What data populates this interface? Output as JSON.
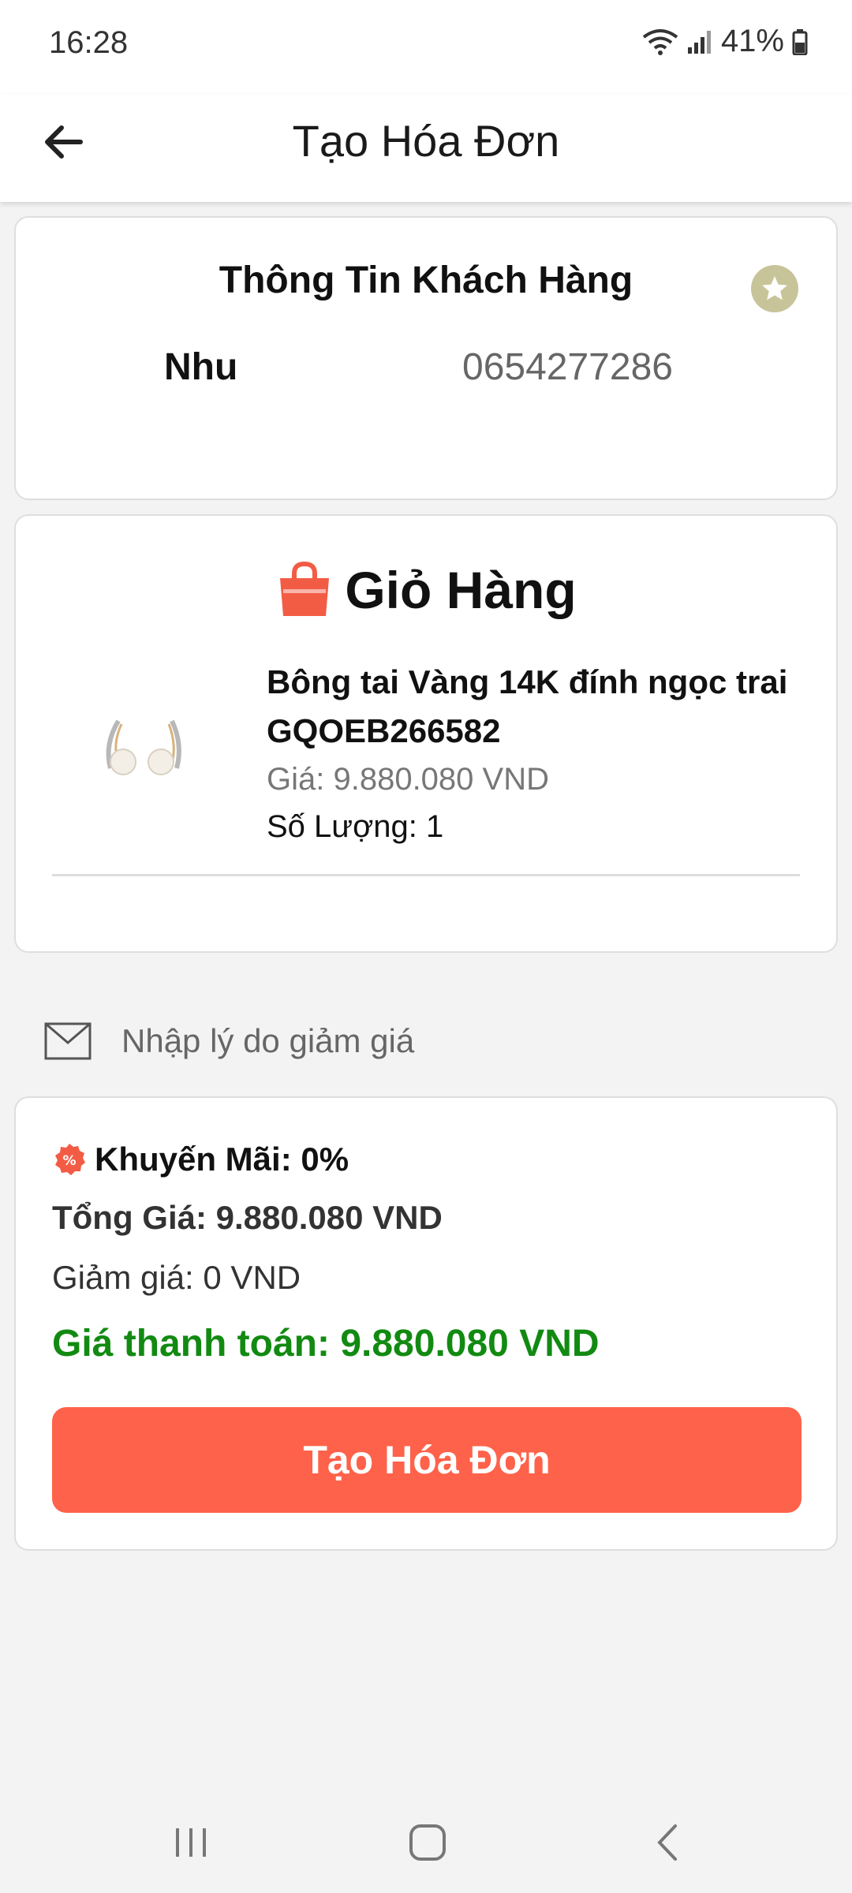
{
  "status_bar": {
    "time": "16:28",
    "battery": "41%"
  },
  "app_bar": {
    "title": "Tạo Hóa Đơn",
    "back_icon": "arrow-left-icon"
  },
  "customer": {
    "title": "Thông Tin Khách Hàng",
    "name": "Nhu",
    "phone": "0654277286",
    "favorite_icon": "star-icon"
  },
  "cart": {
    "title": "Giỏ Hàng",
    "icon": "shopping-bag-icon",
    "items": [
      {
        "name": "Bông tai Vàng 14K đính ngọc trai GQOEB266582",
        "price": "Giá: 9.880.080 VND",
        "quantity": "Số Lượng: 1"
      }
    ]
  },
  "discount_reason": {
    "placeholder": "Nhập lý do giảm giá",
    "icon": "envelope-icon"
  },
  "summary": {
    "promotion": "Khuyến Mãi: 0%",
    "total": "Tổng Giá: 9.880.080 VND",
    "discount": "Giảm giá: 0 VND",
    "payable": "Giá thanh toán: 9.880.080 VND",
    "submit_label": "Tạo Hóa Đơn"
  },
  "colors": {
    "accent": "#fe624a",
    "payable": "#128a12",
    "favorite": "#c8c49a"
  }
}
